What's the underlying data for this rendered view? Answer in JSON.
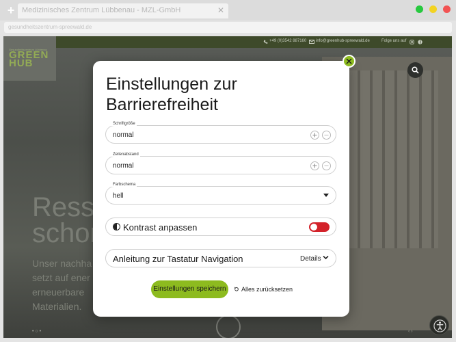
{
  "browser": {
    "tab_title": "Medizinisches Zentrum Lübbenau - MZL-GmbH",
    "close_glyph": "✕",
    "new_tab_glyph": "+",
    "address": "gesundheitszentrum-spreewald.de",
    "window_dots": [
      "#27c93f",
      "#f3d322",
      "#f25353"
    ]
  },
  "site": {
    "phone": "+49 (0)3542 887160",
    "email": "info@greenhub-spreewald.de",
    "follow": "Folge uns auf",
    "logo_small": "Gesundheitszentrum Lübbenau",
    "logo_big_1": "GREEN",
    "logo_big_2": "HUB",
    "hero_line1": "Resso",
    "hero_line2": "schon",
    "hero_paragraph": "Unser nachha setzt auf ener erneuerbare Materialien.",
    "pager_left": "•  ○  •",
    "pager_right": "‹  ›"
  },
  "modal": {
    "title": "Einstellungen zur Barrierefreiheit",
    "font_size": {
      "label": "Schriftgröße",
      "value": "normal"
    },
    "line_height": {
      "label": "Zeilenabstand",
      "value": "normal"
    },
    "color_scheme": {
      "label": "Farbschema",
      "value": "hell"
    },
    "contrast_label": "Kontrast anpassen",
    "contrast_on": false,
    "keyboard_label": "Anleitung zur Tastatur Navigation",
    "details_label": "Details",
    "save_label": "Einstellungen speichern",
    "reset_label": "Alles zurücksetzen"
  },
  "colors": {
    "accent": "#8dbb1f",
    "toggle_off": "#d3222a"
  },
  "icons": [
    "plus-icon",
    "minus-icon",
    "chevron-down-icon",
    "close-icon",
    "contrast-icon",
    "reset-icon",
    "search-icon",
    "accessibility-icon",
    "phone-icon",
    "mail-icon",
    "instagram-icon",
    "facebook-icon"
  ]
}
